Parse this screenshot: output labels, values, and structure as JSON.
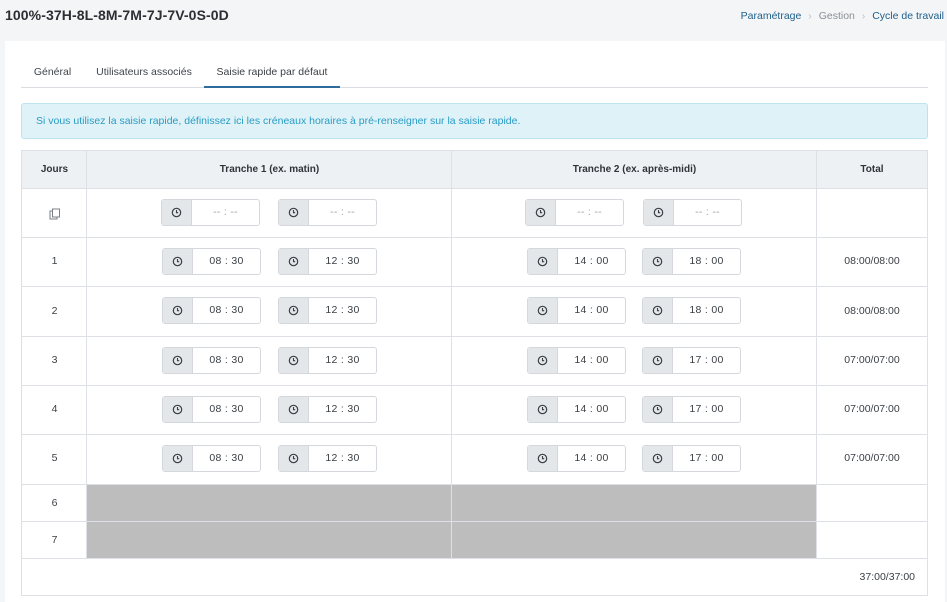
{
  "header": {
    "title": "100%-37H-8L-8M-7M-7J-7V-0S-0D",
    "breadcrumb": [
      "Paramétrage",
      "Gestion",
      "Cycle de travail"
    ]
  },
  "tabs": [
    {
      "label": "Général",
      "active": false
    },
    {
      "label": "Utilisateurs associés",
      "active": false
    },
    {
      "label": "Saisie rapide par défaut",
      "active": true
    }
  ],
  "alert": {
    "text": "Si vous utilisez la saisie rapide, définissez ici les créneaux horaires à pré-renseigner sur la saisie rapide."
  },
  "table": {
    "headers": {
      "days": "Jours",
      "slot1": "Tranche 1 (ex. matin)",
      "slot2": "Tranche 2 (ex. après-midi)",
      "total": "Total"
    },
    "copy_row": {
      "placeholder": "-- : --"
    },
    "rows": [
      {
        "day": "1",
        "t1_start": "08 : 30",
        "t1_end": "12 : 30",
        "t2_start": "14 : 00",
        "t2_end": "18 : 00",
        "total": "08:00/08:00"
      },
      {
        "day": "2",
        "t1_start": "08 : 30",
        "t1_end": "12 : 30",
        "t2_start": "14 : 00",
        "t2_end": "18 : 00",
        "total": "08:00/08:00"
      },
      {
        "day": "3",
        "t1_start": "08 : 30",
        "t1_end": "12 : 30",
        "t2_start": "14 : 00",
        "t2_end": "17 : 00",
        "total": "07:00/07:00"
      },
      {
        "day": "4",
        "t1_start": "08 : 30",
        "t1_end": "12 : 30",
        "t2_start": "14 : 00",
        "t2_end": "17 : 00",
        "total": "07:00/07:00"
      },
      {
        "day": "5",
        "t1_start": "08 : 30",
        "t1_end": "12 : 30",
        "t2_start": "14 : 00",
        "t2_end": "17 : 00",
        "total": "07:00/07:00"
      }
    ],
    "disabled_rows": [
      {
        "day": "6"
      },
      {
        "day": "7"
      }
    ],
    "grand_total": "37:00/37:00"
  }
}
